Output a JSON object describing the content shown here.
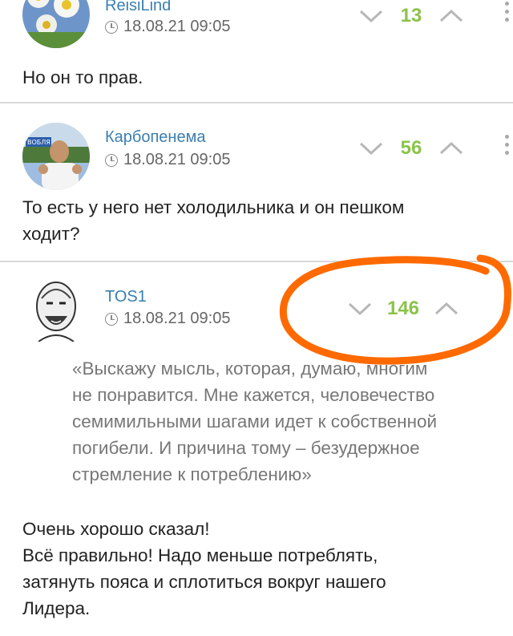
{
  "comments": [
    {
      "username": "ReisiLind",
      "timestamp": "18.08.21 09:05",
      "score": "13",
      "text": "Но он то прав."
    },
    {
      "username": "Карбопенема",
      "timestamp": "18.08.21 09:05",
      "score": "56",
      "text_lines": [
        "То есть у него нет холодильника и он пешком",
        "ходит?"
      ]
    },
    {
      "username": "TOS1",
      "timestamp": "18.08.21 09:05",
      "score": "146",
      "quote_lines": [
        "«Выскажу мысль, которая, думаю, многим",
        "не понравится. Мне кажется, человечество",
        "семимильными шагами идет к собственной",
        "погибели. И причина тому – безудержное",
        "стремление к потреблению»"
      ],
      "text_lines": [
        "Очень хорошо сказал!",
        "Всё правильно! Надо меньше потреблять,",
        "затянуть пояса и сплотиться вокруг нашего",
        "Лидера."
      ]
    }
  ],
  "icons": {
    "clock": "clock-icon",
    "downvote": "chevron-down-icon",
    "upvote": "chevron-up-icon",
    "more": "more-vertical-icon"
  },
  "colors": {
    "username": "#3a7fb0",
    "score": "#8bc34a",
    "annotation": "#ff6a00"
  }
}
